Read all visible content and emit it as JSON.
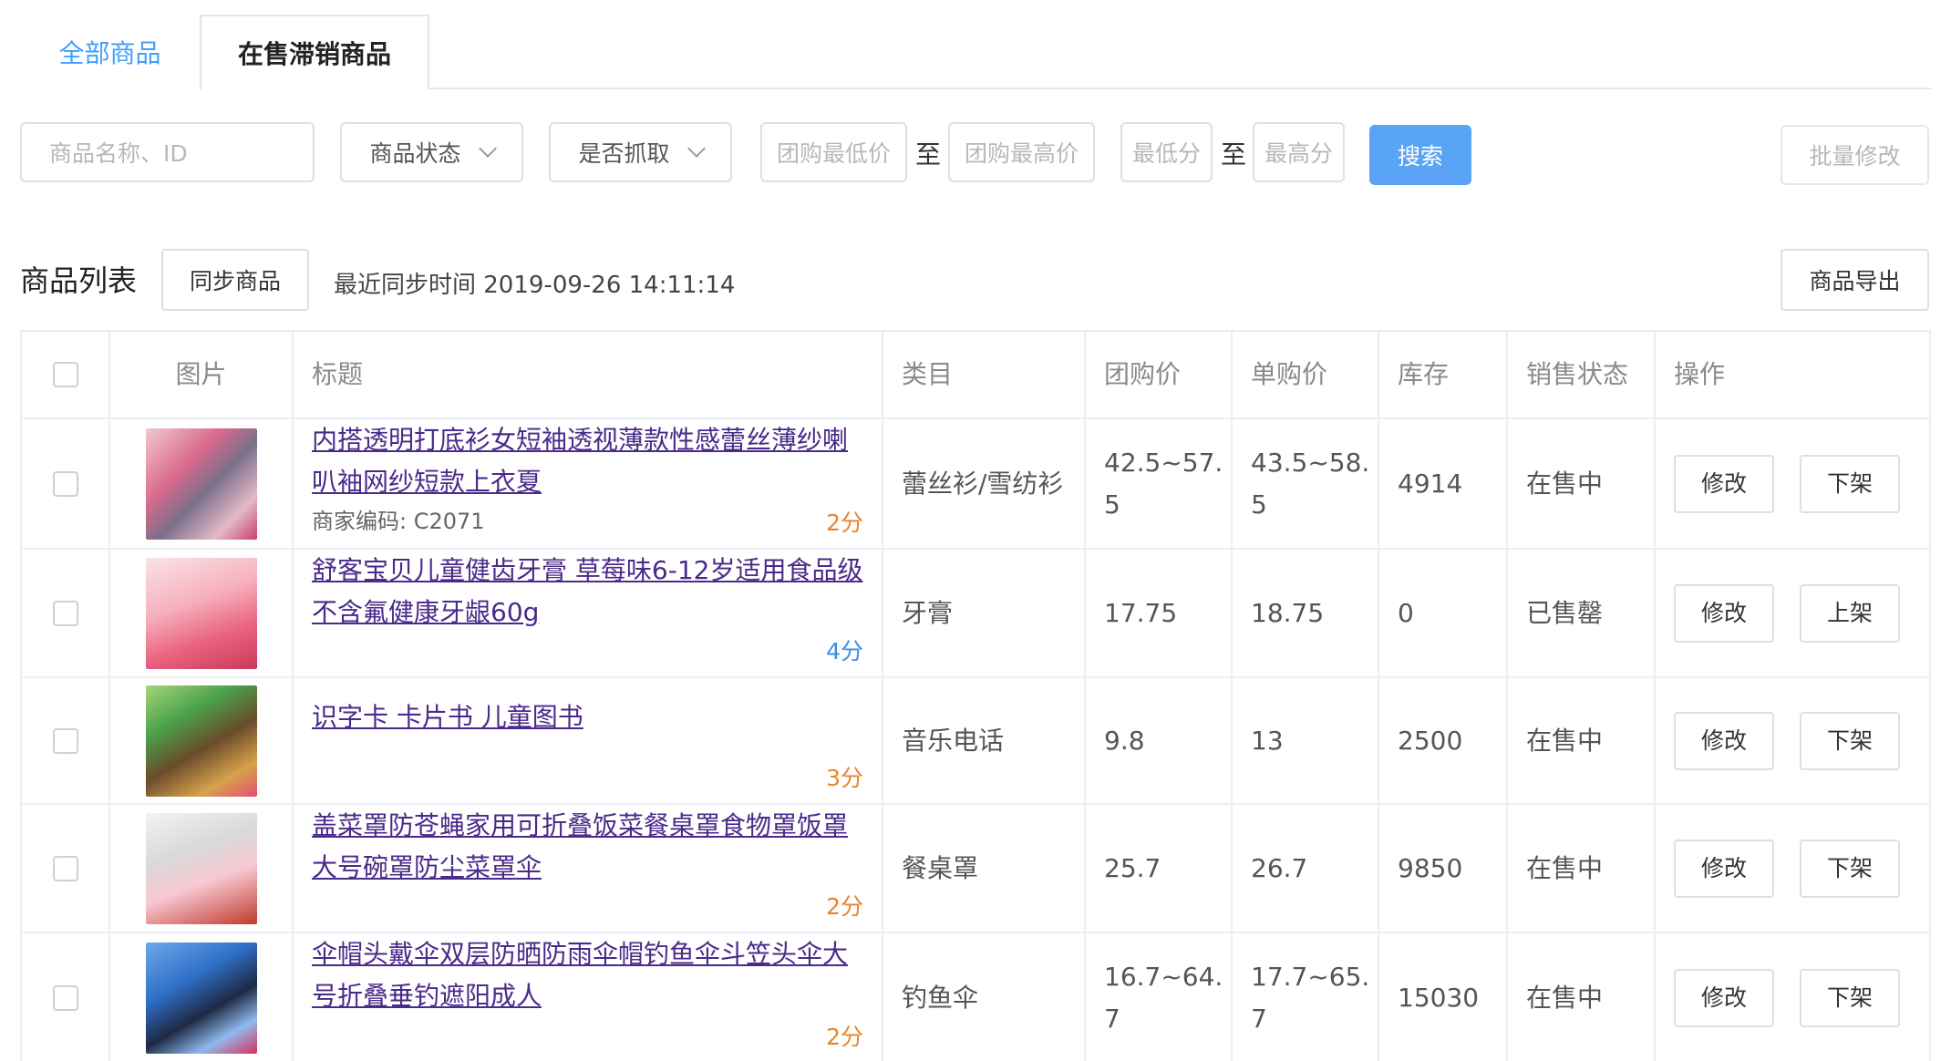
{
  "tabs": [
    {
      "label": "全部商品",
      "active": true
    },
    {
      "label": "在售滞销商品",
      "active": false
    }
  ],
  "filters": {
    "name_placeholder": "商品名称、ID",
    "status_select": "商品状态",
    "grab_select": "是否抓取",
    "group_min_placeholder": "团购最低价",
    "to_label": "至",
    "group_max_placeholder": "团购最高价",
    "score_min_placeholder": "最低分",
    "score_max_placeholder": "最高分",
    "search_button": "搜索",
    "batch_edit_button": "批量修改"
  },
  "list_header": {
    "title": "商品列表",
    "sync_button": "同步商品",
    "sync_time": "最近同步时间 2019-09-26 14:11:14",
    "export_button": "商品导出"
  },
  "table": {
    "columns": [
      "图片",
      "标题",
      "类目",
      "团购价",
      "单购价",
      "库存",
      "销售状态",
      "操作"
    ],
    "rows": [
      {
        "title": "内搭透明打底衫女短袖透视薄款性感蕾丝薄纱喇叭袖网纱短款上衣夏",
        "merchant_code": "商家编码: C2071",
        "score": "2分",
        "category": "蕾丝衫/雪纺衫",
        "group_price": "42.5~57.5",
        "single_price": "43.5~58.5",
        "stock": "4914",
        "status": "在售中",
        "edit": "修改",
        "toggle": "下架"
      },
      {
        "title": "舒客宝贝儿童健齿牙膏 草莓味6-12岁适用食品级不含氟健康牙龈60g",
        "merchant_code": "",
        "score": "4分",
        "category": "牙膏",
        "group_price": "17.75",
        "single_price": "18.75",
        "stock": "0",
        "status": "已售罄",
        "edit": "修改",
        "toggle": "上架"
      },
      {
        "title": "识字卡 卡片书 儿童图书",
        "merchant_code": "",
        "score": "3分",
        "category": "音乐电话",
        "group_price": "9.8",
        "single_price": "13",
        "stock": "2500",
        "status": "在售中",
        "edit": "修改",
        "toggle": "下架"
      },
      {
        "title": "盖菜罩防苍蝇家用可折叠饭菜餐桌罩食物罩饭罩大号碗罩防尘菜罩伞",
        "merchant_code": "",
        "score": "2分",
        "category": "餐桌罩",
        "group_price": "25.7",
        "single_price": "26.7",
        "stock": "9850",
        "status": "在售中",
        "edit": "修改",
        "toggle": "下架"
      },
      {
        "title": "伞帽头戴伞双层防晒防雨伞帽钓鱼伞斗笠头伞大号折叠垂钓遮阳成人",
        "merchant_code": "",
        "score": "2分",
        "category": "钓鱼伞",
        "group_price": "16.7~64.7",
        "single_price": "17.7~65.7",
        "stock": "15030",
        "status": "在售中",
        "edit": "修改",
        "toggle": "下架"
      }
    ]
  },
  "colors": {
    "accent": "#409eff",
    "search_button_bg": "#5aa4f6",
    "link": "#4a2a8a",
    "score_orange": "#e6862a",
    "score_blue": "#3a8ee6"
  }
}
